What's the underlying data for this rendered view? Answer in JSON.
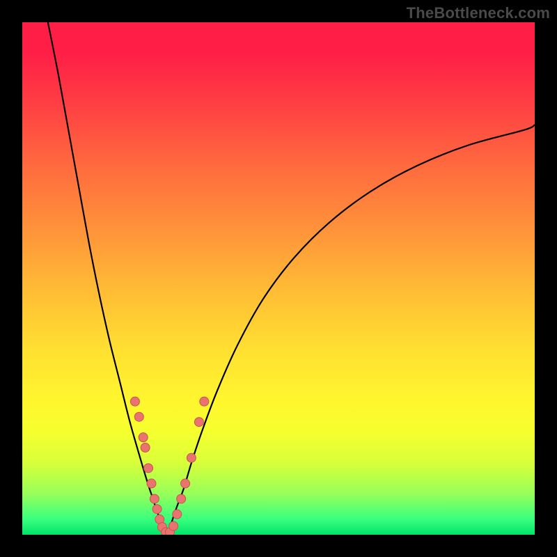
{
  "watermark": "TheBottleneck.com",
  "colors": {
    "frame": "#000000",
    "curve": "#000000",
    "dot_fill": "#e9746f",
    "dot_stroke": "#c9534f",
    "gradient_top": "#ff1f46",
    "gradient_bottom": "#00e46b"
  },
  "chart_data": {
    "type": "line",
    "title": "",
    "xlabel": "",
    "ylabel": "",
    "xlim": [
      0,
      100
    ],
    "ylim": [
      0,
      100
    ],
    "grid": false,
    "series": [
      {
        "name": "left-curve",
        "x": [
          5,
          7,
          9,
          11,
          13,
          15,
          17,
          19,
          21,
          23,
          24.5,
          25.5,
          26.5,
          27.5,
          28.2
        ],
        "y": [
          100,
          90,
          79,
          68,
          57,
          47,
          38,
          30,
          22,
          15,
          10,
          7,
          4,
          2,
          0
        ]
      },
      {
        "name": "right-curve",
        "x": [
          28.2,
          29,
          30,
          31.5,
          33,
          35,
          38,
          42,
          47,
          53,
          60,
          68,
          77,
          87,
          98,
          100
        ],
        "y": [
          0,
          2,
          5,
          9,
          14,
          20,
          28,
          37,
          46,
          54,
          61,
          67,
          72,
          76,
          79,
          80
        ]
      }
    ],
    "scatter_points": {
      "name": "highlighted-points",
      "points": [
        {
          "x": 22.0,
          "y": 26
        },
        {
          "x": 22.8,
          "y": 23
        },
        {
          "x": 23.6,
          "y": 19
        },
        {
          "x": 24.0,
          "y": 17
        },
        {
          "x": 24.6,
          "y": 13
        },
        {
          "x": 25.2,
          "y": 10
        },
        {
          "x": 25.8,
          "y": 7
        },
        {
          "x": 26.3,
          "y": 5
        },
        {
          "x": 26.8,
          "y": 3
        },
        {
          "x": 27.3,
          "y": 1.5
        },
        {
          "x": 28.0,
          "y": 0.5
        },
        {
          "x": 28.8,
          "y": 0.5
        },
        {
          "x": 29.5,
          "y": 1.7
        },
        {
          "x": 30.2,
          "y": 4
        },
        {
          "x": 31.0,
          "y": 7
        },
        {
          "x": 31.8,
          "y": 10
        },
        {
          "x": 33.0,
          "y": 15
        },
        {
          "x": 34.5,
          "y": 22
        },
        {
          "x": 35.5,
          "y": 26
        }
      ]
    },
    "notes": "x and y are 0-100 relative to the gradient plot area; y=0 is bottom (green), y=100 is top (red). Curve is a V-shaped bottleneck profile with minimum near x≈28."
  }
}
